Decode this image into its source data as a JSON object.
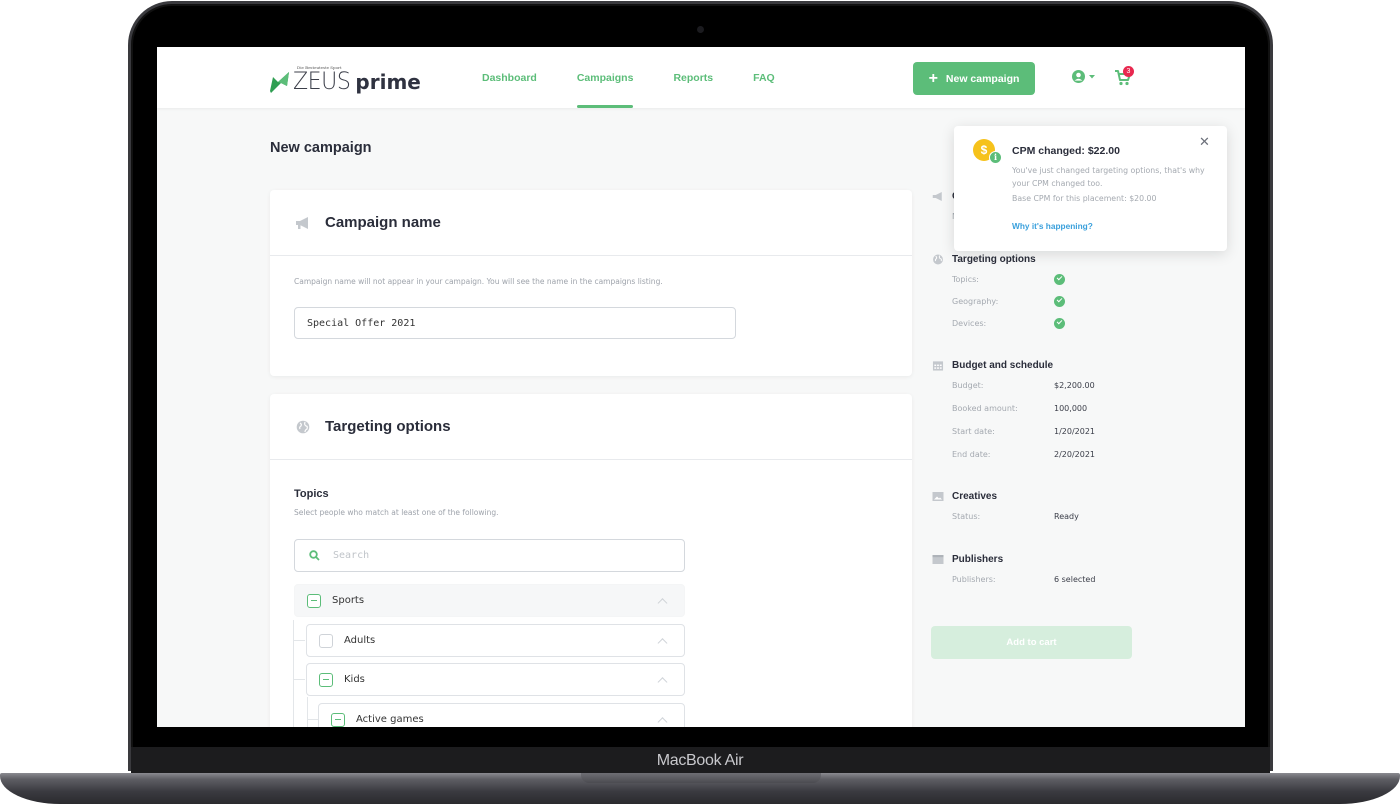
{
  "device": {
    "label": "MacBook Air"
  },
  "navbar": {
    "logo": {
      "tagline": "Die Besteuteste Sport",
      "brand": "ZEUS",
      "suffix": "prime"
    },
    "links": [
      {
        "label": "Dashboard",
        "active": false
      },
      {
        "label": "Campaigns",
        "active": true
      },
      {
        "label": "Reports",
        "active": false
      },
      {
        "label": "FAQ",
        "active": false
      }
    ],
    "new_campaign_label": "New campaign",
    "cart_count": "3",
    "accent_color": "#5cbd79"
  },
  "page": {
    "title": "New campaign"
  },
  "campaign_name_card": {
    "title": "Campaign name",
    "help": "Campaign name will not appear in your campaign. You will see the name in the campaigns listing.",
    "value": "Special Offer 2021"
  },
  "targeting_card": {
    "title": "Targeting options",
    "topics_title": "Topics",
    "topics_help": "Select people who match at least one of the following.",
    "search_placeholder": "Search",
    "tree": [
      {
        "label": "Sports",
        "state": "partial",
        "level": 0
      },
      {
        "label": "Adults",
        "state": "unchecked",
        "level": 1
      },
      {
        "label": "Kids",
        "state": "partial",
        "level": 1
      },
      {
        "label": "Active games",
        "state": "partial",
        "level": 2
      }
    ]
  },
  "summary": {
    "campaign_section": {
      "title": "Campaign name",
      "key": "Name:"
    },
    "targeting": {
      "title": "Targeting options",
      "rows": [
        {
          "key": "Topics:",
          "status": "ok"
        },
        {
          "key": "Geography:",
          "status": "ok"
        },
        {
          "key": "Devices:",
          "status": "ok"
        }
      ]
    },
    "budget": {
      "title": "Budget and schedule",
      "rows": [
        {
          "key": "Budget:",
          "value": "$2,200.00"
        },
        {
          "key": "Booked amount:",
          "value": "100,000"
        },
        {
          "key": "Start date:",
          "value": "1/20/2021"
        },
        {
          "key": "End date:",
          "value": "2/20/2021"
        }
      ]
    },
    "creatives": {
      "title": "Creatives",
      "rows": [
        {
          "key": "Status:",
          "value": "Ready"
        }
      ]
    },
    "publishers": {
      "title": "Publishers",
      "rows": [
        {
          "key": "Publishers:",
          "value": "6 selected"
        }
      ]
    },
    "add_to_cart_label": "Add to cart"
  },
  "toast": {
    "title": "CPM changed: $22.00",
    "body": "You've just changed targeting options, that's why your CPM changed too.",
    "base": "Base CPM for this placement: $20.00",
    "link": "Why it's happening?",
    "coin_symbol": "$",
    "info_symbol": "i",
    "close_symbol": "✕"
  }
}
